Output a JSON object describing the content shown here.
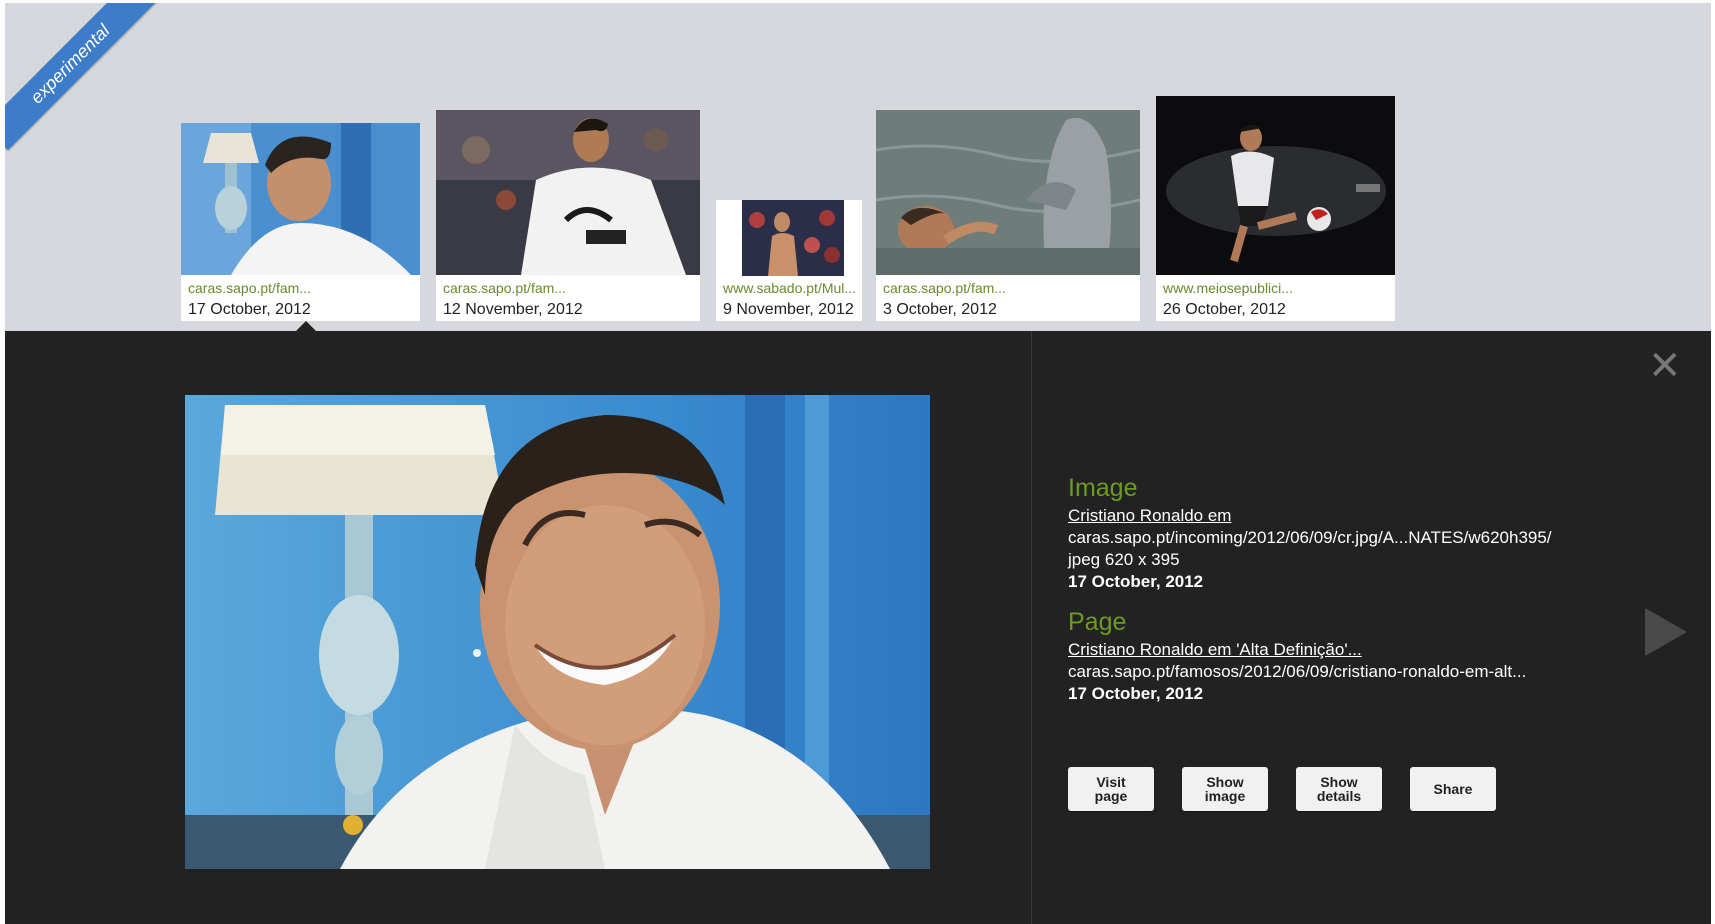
{
  "ribbon": "experimental",
  "thumbnails": [
    {
      "source": "caras.sapo.pt/fam...",
      "date": "17 October, 2012",
      "image": "smiling-man-white-polo-photo"
    },
    {
      "source": "caras.sapo.pt/fam...",
      "date": "12 November, 2012",
      "image": "footballer-white-jersey-photo"
    },
    {
      "source": "www.sabado.pt/Mul...",
      "date": "9 November, 2012",
      "image": "shirtless-footballer-photo"
    },
    {
      "source": "caras.sapo.pt/fam...",
      "date": "3 October, 2012",
      "image": "man-with-dolphin-photo"
    },
    {
      "source": "www.meiosepublici...",
      "date": "26 October, 2012",
      "image": "footballer-kicking-ball-ad-photo"
    }
  ],
  "detail": {
    "close_icon": "close-icon",
    "next_icon": "next-arrow-icon",
    "main_image": "smiling-man-white-polo-photo",
    "image_section": {
      "title": "Image",
      "link": "Cristiano Ronaldo em ",
      "url": "caras.sapo.pt/incoming/2012/06/09/cr.jpg/A...NATES/w620h395/",
      "format": "jpeg 620 x 395",
      "date": "17 October, 2012"
    },
    "page_section": {
      "title": "Page",
      "link": "Cristiano Ronaldo em 'Alta Definição'...",
      "url": "caras.sapo.pt/famosos/2012/06/09/cristiano-ronaldo-em-alt...",
      "date": "17 October, 2012"
    },
    "buttons": [
      {
        "line1": "Visit",
        "line2": "page"
      },
      {
        "line1": "Show",
        "line2": "image"
      },
      {
        "line1": "Show",
        "line2": "details"
      },
      {
        "line1": "Share",
        "line2": ""
      }
    ]
  },
  "colors": {
    "strip_background": "#d6d8dd",
    "panel_background": "#222222",
    "section_title": "#6e9a1f",
    "thumb_source": "#6a8a2b",
    "ribbon": "#3d7cc9"
  }
}
